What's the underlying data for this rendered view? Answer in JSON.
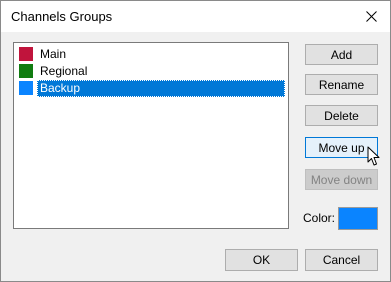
{
  "window": {
    "title": "Channels Groups",
    "close_icon": "close-icon"
  },
  "groups": [
    {
      "label": "Main",
      "color": "#c0143c",
      "selected": false
    },
    {
      "label": "Regional",
      "color": "#107c10",
      "selected": false
    },
    {
      "label": "Backup",
      "color": "#0a84ff",
      "selected": true
    }
  ],
  "actions": {
    "add": "Add",
    "rename": "Rename",
    "delete": "Delete",
    "move_up": "Move up",
    "move_down": "Move down"
  },
  "color_picker": {
    "label": "Color:",
    "value": "#0a84ff"
  },
  "footer": {
    "ok": "OK",
    "cancel": "Cancel"
  },
  "colors": {
    "selection": "#0078d7",
    "hover_border": "#0078d7"
  },
  "cursor_icon": "arrow-cursor-icon"
}
